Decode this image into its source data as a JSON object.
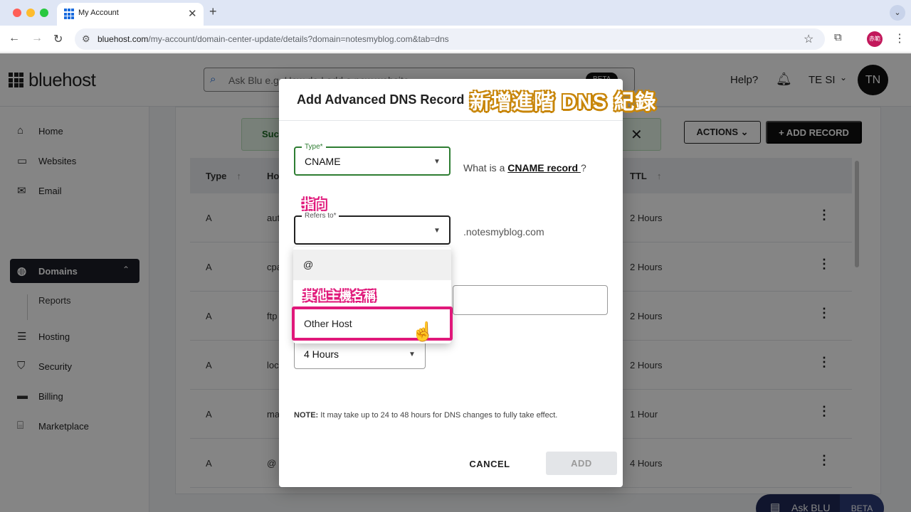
{
  "browser": {
    "tab_title": "My Account",
    "tab_close": "✕",
    "new_tab": "+",
    "tab_menu": "⌄",
    "url_host": "bluehost.com",
    "url_path": "/my-account/domain-center-update/details?domain=notesmyblog.com&tab=dns",
    "profile_label": "赤範"
  },
  "header": {
    "logo": "bluehost",
    "search_placeholder": "Ask Blu e.g. How do I add a new website",
    "search_beta": "BETA",
    "help": "Help?",
    "user": "TE SI",
    "avatar": "TN"
  },
  "sidebar": {
    "items": [
      {
        "label": "Home",
        "icon": "home-icon"
      },
      {
        "label": "Websites",
        "icon": "browser-window-icon"
      },
      {
        "label": "Email",
        "icon": "mail-icon"
      },
      {
        "label": "Domains",
        "icon": "globe-icon"
      },
      {
        "label": "Reports",
        "icon": ""
      },
      {
        "label": "Hosting",
        "icon": "server-icon"
      },
      {
        "label": "Security",
        "icon": "shield-icon"
      },
      {
        "label": "Billing",
        "icon": "card-icon"
      },
      {
        "label": "Marketplace",
        "icon": "store-icon"
      }
    ]
  },
  "content": {
    "alert_text": "Suc",
    "actions_label": "ACTIONS",
    "add_record_label": "+ ADD RECORD",
    "columns": [
      "Type",
      "Ho",
      "TTL"
    ],
    "rows": [
      {
        "type": "A",
        "host": "aut",
        "ttl": "2 Hours"
      },
      {
        "type": "A",
        "host": "cpa",
        "ttl": "2 Hours"
      },
      {
        "type": "A",
        "host": "ftp",
        "ttl": "2 Hours"
      },
      {
        "type": "A",
        "host": "loc",
        "ttl": "2 Hours"
      },
      {
        "type": "A",
        "host": "ma",
        "ttl": "1 Hour"
      },
      {
        "type": "A",
        "host": "@",
        "ttl": "4 Hours"
      }
    ],
    "ask_blu": "Ask BLU",
    "ask_blu_beta": "BETA"
  },
  "modal": {
    "title": "Add Advanced DNS Record",
    "type_legend": "Type*",
    "type_value": "CNAME",
    "type_help_prefix": "What is a ",
    "type_help_link": "CNAME record ",
    "type_help_suffix": "?",
    "refers_legend": "Refers to*",
    "refers_value": "",
    "domain_suffix": ".notesmyblog.com",
    "dropdown_options": [
      "@",
      "Other Host"
    ],
    "ttl_value": "4 Hours",
    "note_label": "NOTE:",
    "note_text": " It may take up to 24 to 48 hours for DNS changes to fully take effect.",
    "cancel": "CANCEL",
    "add": "ADD"
  },
  "annotations": {
    "title": "新增進階 DNS 紀錄",
    "refers_to": "指向",
    "other_host": "其他主機名稱"
  },
  "colors": {
    "accent_pink": "#e0187a",
    "success_green": "#2e7d32",
    "brand_blue": "#196bde"
  }
}
